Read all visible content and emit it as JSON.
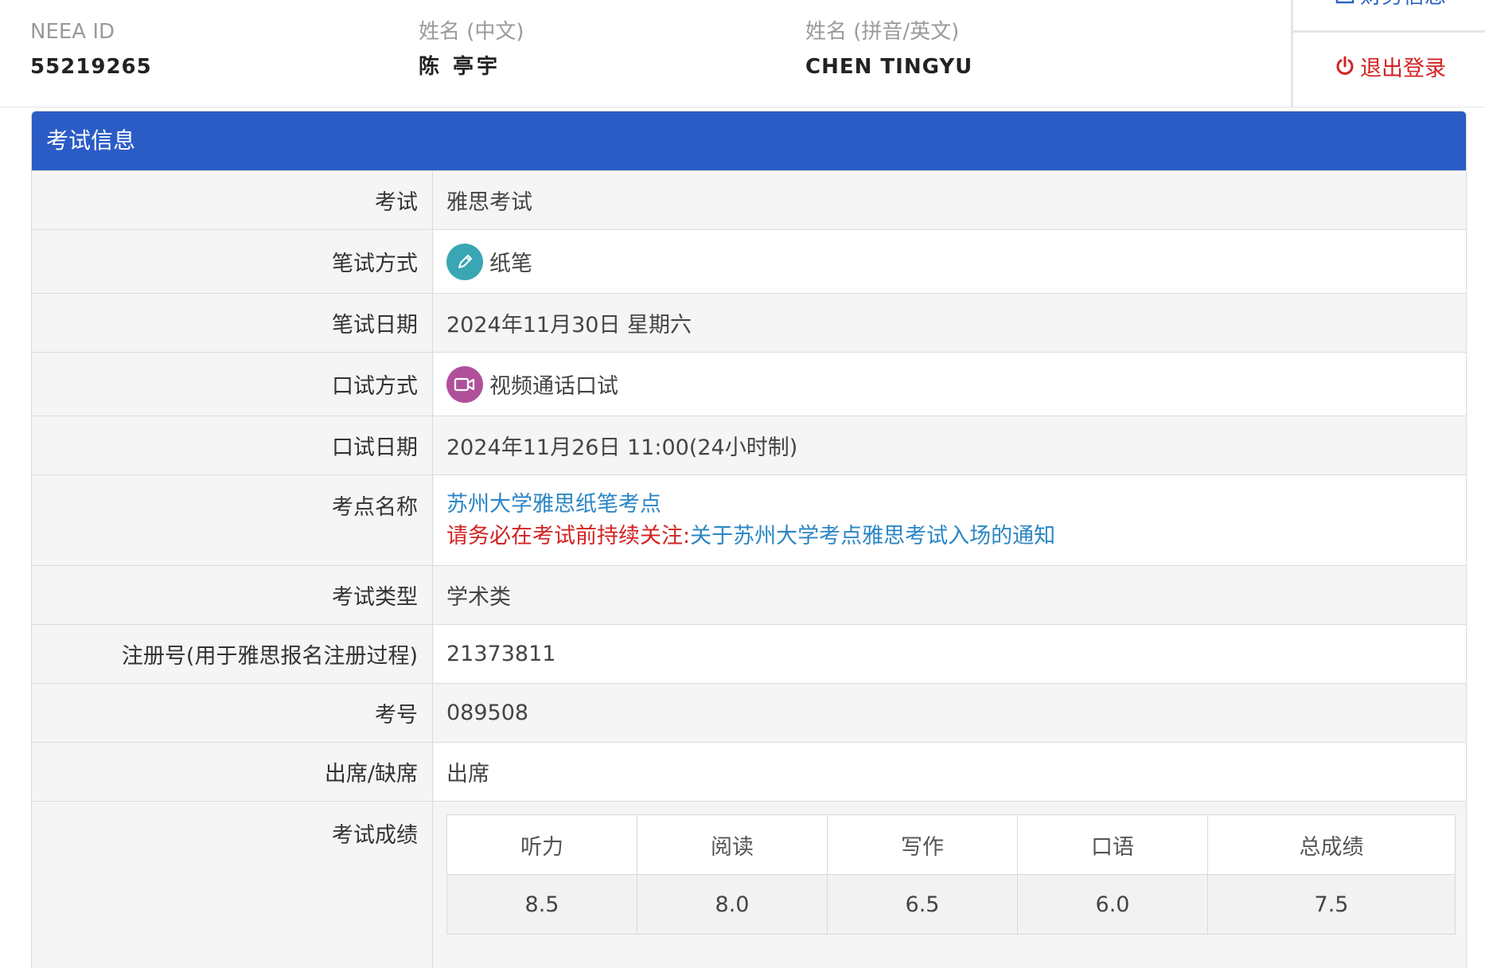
{
  "header": {
    "neea_id_label": "NEEA ID",
    "neea_id_value": "55219265",
    "name_cn_label": "姓名 (中文)",
    "name_cn_value": "陈 亭宇",
    "name_en_label": "姓名 (拼音/英文)",
    "name_en_value": "CHEN TINGYU"
  },
  "side_menu": {
    "finance_label": "财务信息",
    "logout_label": "退出登录"
  },
  "panel": {
    "title": "考试信息",
    "rows": {
      "exam": {
        "label": "考试",
        "value": "雅思考试"
      },
      "written_mode": {
        "label": "笔试方式",
        "value": "纸笔"
      },
      "written_date": {
        "label": "笔试日期",
        "value": "2024年11月30日 星期六"
      },
      "oral_mode": {
        "label": "口试方式",
        "value": "视频通话口试"
      },
      "oral_date": {
        "label": "口试日期",
        "value": "2024年11月26日 11:00(24小时制)"
      },
      "venue": {
        "label": "考点名称",
        "value": "苏州大学雅思纸笔考点",
        "notice_prefix": "请务必在考试前持续关注:",
        "notice_link": "关于苏州大学考点雅思考试入场的通知"
      },
      "exam_type": {
        "label": "考试类型",
        "value": "学术类"
      },
      "registration": {
        "label": "注册号(用于雅思报名注册过程)",
        "value": "21373811"
      },
      "candidate_no": {
        "label": "考号",
        "value": "089508"
      },
      "attendance": {
        "label": "出席/缺席",
        "value": "出席"
      },
      "scores": {
        "label": "考试成绩",
        "headers": [
          "听力",
          "阅读",
          "写作",
          "口语",
          "总成绩"
        ],
        "values": [
          "8.5",
          "8.0",
          "6.5",
          "6.0",
          "7.5"
        ]
      }
    }
  },
  "colors": {
    "panel_header": "#2b5cc6",
    "link": "#2b86c5",
    "warning": "#d32323",
    "pen_icon": "#3aa6b4",
    "video_icon": "#b0509a"
  }
}
